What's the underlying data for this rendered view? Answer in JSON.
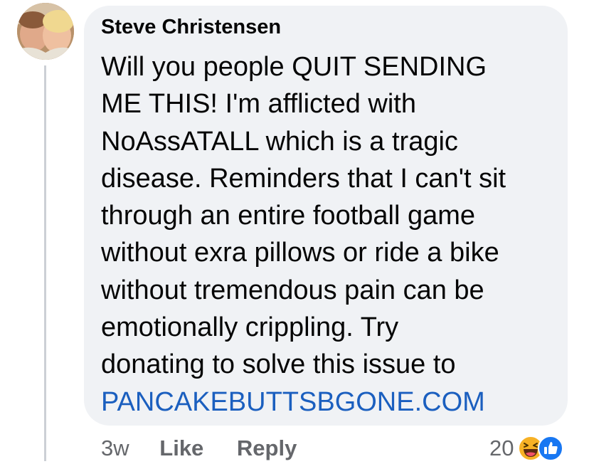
{
  "comment": {
    "author": "Steve Christensen",
    "body_lines": [
      "Will you people QUIT SENDING",
      "ME THIS! I'm afflicted with",
      "NoAssATALL which is a tragic",
      "disease. Reminders that I can't sit",
      "through an entire football game",
      "without exra pillows or ride a bike",
      "without tremendous pain can be",
      "emotionally crippling. Try",
      "donating to solve this issue to"
    ],
    "link_text": "PANCAKEBUTTSBGONE.COM",
    "timestamp": "3w",
    "like_label": "Like",
    "reply_label": "Reply",
    "reaction_count": "20",
    "reaction_icons": [
      "laugh-emoji-icon",
      "like-thumb-icon"
    ]
  },
  "colors": {
    "bubble": "#f0f2f5",
    "text": "#050505",
    "muted": "#65676b",
    "link": "#1b5fbf",
    "like_blue": "#1877f2",
    "laugh_yellow": "#f7b125"
  }
}
